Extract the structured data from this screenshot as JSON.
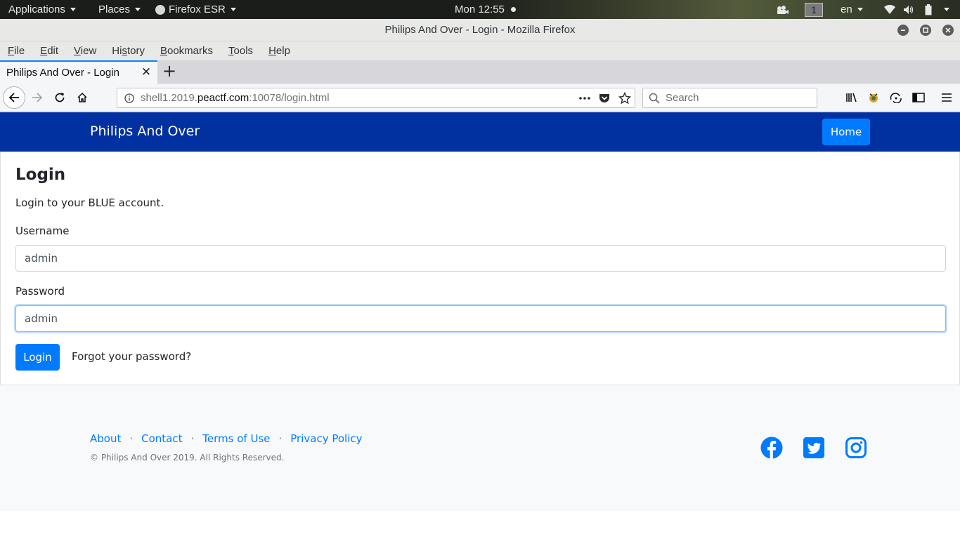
{
  "panel": {
    "applications": "Applications",
    "places": "Places",
    "firefox": "Firefox ESR",
    "clock": "Mon 12:55",
    "workspace": "1",
    "language": "en"
  },
  "window": {
    "title": "Philips And Over - Login - Mozilla Firefox"
  },
  "menubar": {
    "items": [
      {
        "label": "File",
        "key": "F",
        "rest": "ile"
      },
      {
        "label": "Edit",
        "key": "E",
        "rest": "dit"
      },
      {
        "label": "View",
        "key": "V",
        "rest": "iew"
      },
      {
        "label": "History",
        "pre": "Hi",
        "key": "s",
        "rest": "tory"
      },
      {
        "label": "Bookmarks",
        "key": "B",
        "rest": "ookmarks"
      },
      {
        "label": "Tools",
        "key": "T",
        "rest": "ools"
      },
      {
        "label": "Help",
        "key": "H",
        "rest": "elp"
      }
    ]
  },
  "tabs": {
    "active_title": "Philips And Over - Login"
  },
  "urlbar": {
    "prefix": "shell1.2019.",
    "domain": "peactf.com",
    "suffix": ":10078/login.html"
  },
  "search": {
    "placeholder": "Search"
  },
  "site": {
    "brand": "Philips And Over",
    "home_button": "Home",
    "heading": "Login",
    "lead": "Login to your BLUE account.",
    "username_label": "Username",
    "username_value": "admin",
    "password_label": "Password",
    "password_value": "admin",
    "login_button": "Login",
    "forgot_link": "Forgot your password?"
  },
  "footer": {
    "links": [
      "About",
      "Contact",
      "Terms of Use",
      "Privacy Policy"
    ],
    "separator": "·",
    "copyright": "© Philips And Over 2019. All Rights Reserved.",
    "social": [
      "facebook-icon",
      "twitter-icon",
      "instagram-icon"
    ],
    "social_color": "#007bff"
  },
  "colors": {
    "navbar": "#0131a1",
    "primary": "#007bff",
    "footer_bg": "#f8f9fa"
  }
}
